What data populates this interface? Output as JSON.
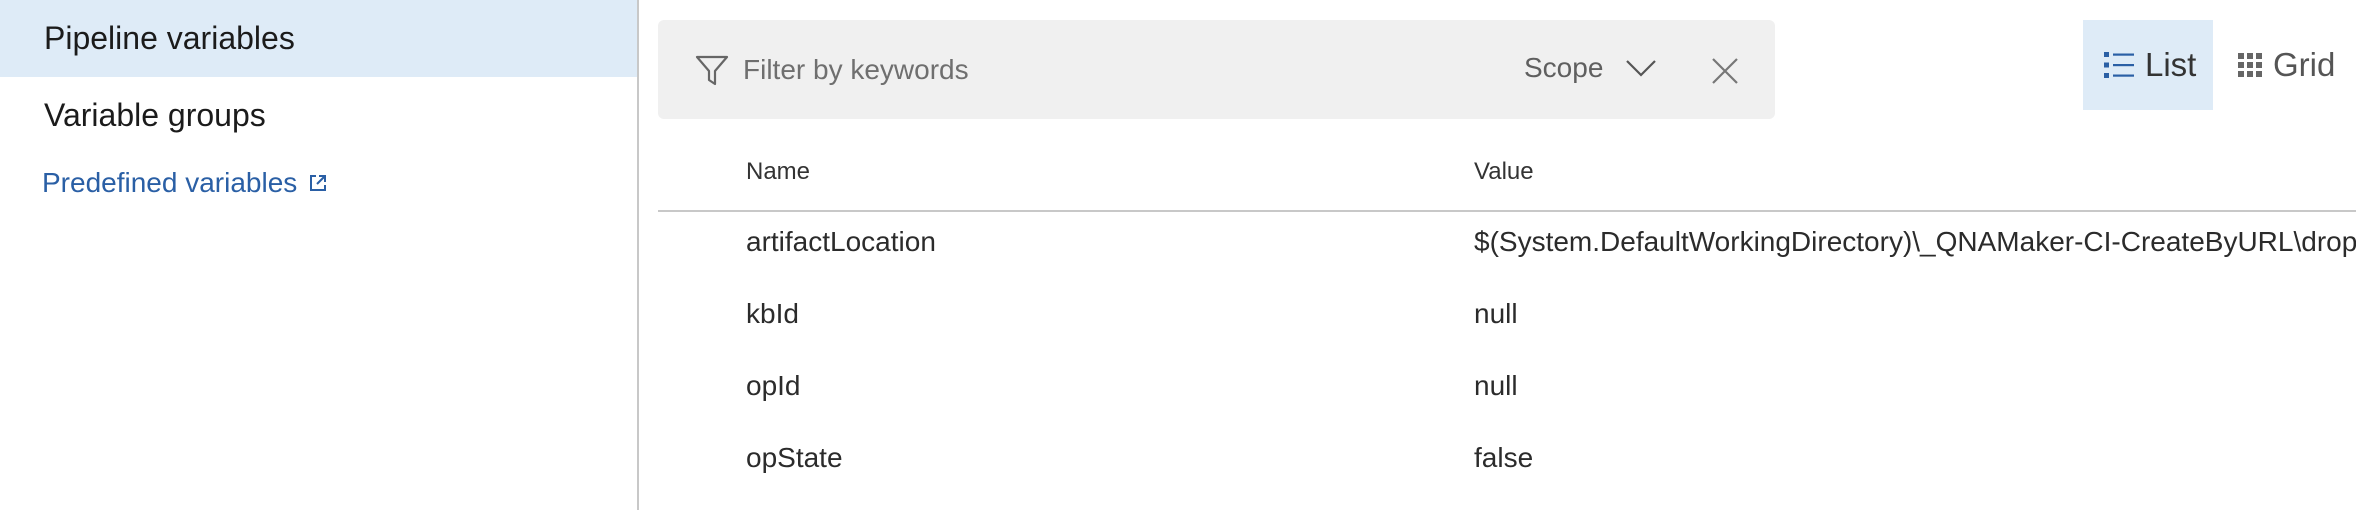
{
  "sidebar": {
    "items": [
      {
        "label": "Pipeline variables",
        "selected": true
      },
      {
        "label": "Variable groups",
        "selected": false
      }
    ],
    "predefined_link": {
      "label": "Predefined variables",
      "icon": "external-link-icon"
    }
  },
  "filter": {
    "placeholder": "Filter by keywords",
    "value": "",
    "scope_label": "Scope",
    "icons": {
      "filter": "filter-funnel-icon",
      "scope": "chevron-down-icon",
      "clear": "close-icon"
    }
  },
  "view_toggle": {
    "list_label": "List",
    "grid_label": "Grid",
    "active": "List"
  },
  "table": {
    "columns": {
      "name": "Name",
      "value": "Value"
    },
    "rows": [
      {
        "name": "artifactLocation",
        "value": "$(System.DefaultWorkingDirectory)\\_QNAMaker-CI-CreateByURL\\drop"
      },
      {
        "name": "kbId",
        "value": "null"
      },
      {
        "name": "opId",
        "value": "null"
      },
      {
        "name": "opState",
        "value": "false"
      }
    ]
  },
  "colors": {
    "selected_bg": "#deebf7",
    "link": "#2a5fa5",
    "filter_bg": "#f0f0f0",
    "divider": "#c8c8c8"
  }
}
